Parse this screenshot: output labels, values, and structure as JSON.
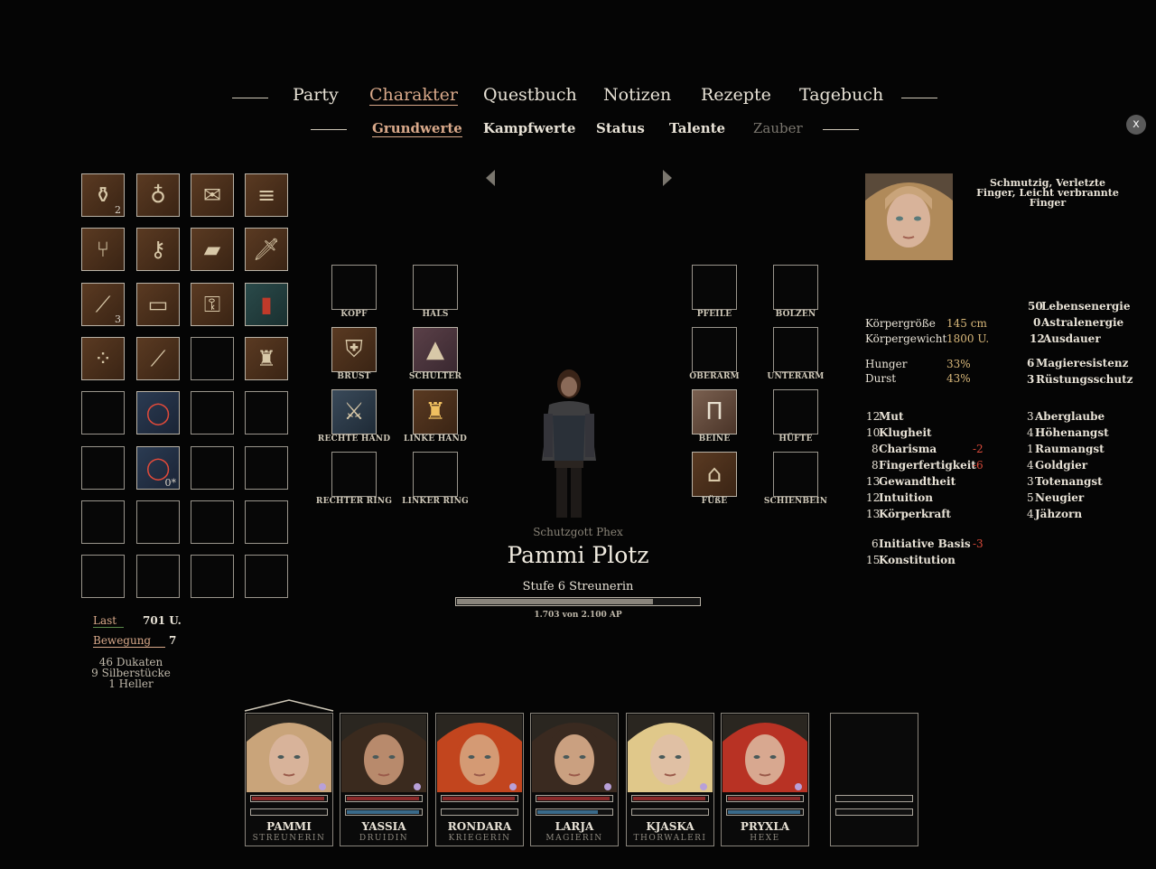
{
  "nav": {
    "main": [
      "Party",
      "Charakter",
      "Questbuch",
      "Notizen",
      "Rezepte",
      "Tagebuch"
    ],
    "sub": [
      "Grundwerte",
      "Kampfwerte",
      "Status",
      "Talente",
      "Zauber"
    ],
    "close_label": "x"
  },
  "inventory": {
    "counts": {
      "s0": "2",
      "s8": "3",
      "s21": "0*"
    },
    "load_label": "Last",
    "load_value": "701 U.",
    "movement_label": "Bewegung",
    "movement_value": "7",
    "money": [
      "46 Dukaten",
      "9 Silberstücke",
      "1 Heller"
    ]
  },
  "equipment": {
    "kopf": "KOPF",
    "hals": "HALS",
    "pfeile": "PFEILE",
    "bolzen": "BOLZEN",
    "brust": "BRUST",
    "schulter": "SCHULTER",
    "oberarm": "OBERARM",
    "unterarm": "UNTERARM",
    "rechte_hand": "RECHTE HAND",
    "linke_hand": "LINKE HAND",
    "beine": "BEINE",
    "huefte": "HÜFTE",
    "rechter_ring": "RECHTER RING",
    "linker_ring": "LINKER RING",
    "fuesse": "FÜßE",
    "schienbein": "SCHIENBEIN"
  },
  "character": {
    "deity": "Schutzgott Phex",
    "name": "Pammi Plotz",
    "level": "Stufe 6 Streunerin",
    "xp_text": "1.703 von 2.100 AP",
    "xp_current": 1703,
    "xp_max": 2100,
    "conditions_line1": "Schmutzig, Verletzte",
    "conditions_line2": "Finger, Leicht verbrannte",
    "conditions_line3": "Finger"
  },
  "body": {
    "height_label": "Körpergröße",
    "height_value": "145 cm",
    "weight_label": "Körpergewicht",
    "weight_value": "1800 U.",
    "hunger_label": "Hunger",
    "hunger_value": "33%",
    "thirst_label": "Durst",
    "thirst_value": "43%"
  },
  "energy": {
    "le": "50",
    "le_label": "Lebensenergie",
    "ae": "0",
    "ae_label": "Astralenergie",
    "au": "12",
    "au_label": "Ausdauer",
    "mr": "6",
    "mr_label": "Magieresistenz",
    "rs": "3",
    "rs_label": "Rüstungsschutz"
  },
  "attributes": [
    {
      "v": "12",
      "n": "Mut",
      "mod": ""
    },
    {
      "v": "10",
      "n": "Klugheit",
      "mod": ""
    },
    {
      "v": "8",
      "n": "Charisma",
      "mod": "-2"
    },
    {
      "v": "8",
      "n": "Fingerfertigkeit",
      "mod": "-6"
    },
    {
      "v": "13",
      "n": "Gewandtheit",
      "mod": ""
    },
    {
      "v": "12",
      "n": "Intuition",
      "mod": ""
    },
    {
      "v": "13",
      "n": "Körperkraft",
      "mod": ""
    }
  ],
  "derived": [
    {
      "v": "6",
      "n": "Initiative Basis",
      "mod": "-3"
    },
    {
      "v": "15",
      "n": "Konstitution",
      "mod": ""
    }
  ],
  "traits": [
    {
      "v": "3",
      "n": "Aberglaube"
    },
    {
      "v": "4",
      "n": "Höhenangst"
    },
    {
      "v": "1",
      "n": "Raumangst"
    },
    {
      "v": "4",
      "n": "Goldgier"
    },
    {
      "v": "3",
      "n": "Totenangst"
    },
    {
      "v": "5",
      "n": "Neugier"
    },
    {
      "v": "4",
      "n": "Jähzorn"
    }
  ],
  "party": [
    {
      "name": "PAMMI",
      "cls": "STREUNERIN",
      "hp": 0.95,
      "mp": 0,
      "hair": "#c9a47a",
      "skin": "#d8b39a"
    },
    {
      "name": "YASSIA",
      "cls": "DRUIDIN",
      "hp": 0.95,
      "mp": 0.95,
      "hair": "#3a2a1e",
      "skin": "#b88a6c"
    },
    {
      "name": "RONDARA",
      "cls": "KRIEGERIN",
      "hp": 0.95,
      "mp": 0,
      "hair": "#c2451e",
      "skin": "#d49a74"
    },
    {
      "name": "LARJA",
      "cls": "MAGIERIN",
      "hp": 0.95,
      "mp": 0.8,
      "hair": "#3a2a20",
      "skin": "#caa080"
    },
    {
      "name": "KJASKA",
      "cls": "THORWALERI",
      "hp": 0.95,
      "mp": 0,
      "hair": "#e0c88a",
      "skin": "#e0c0a4"
    },
    {
      "name": "PRYXLA",
      "cls": "HEXE",
      "hp": 0.95,
      "mp": 0.95,
      "hair": "#b83224",
      "skin": "#d8a890"
    }
  ],
  "colors": {
    "accent": "#d9a98a",
    "hp": "#8a2a2a",
    "mp": "#3a6a8a",
    "mod_negative": "#d94a3a"
  }
}
